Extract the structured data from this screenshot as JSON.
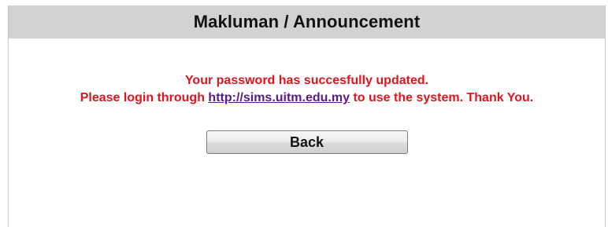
{
  "announcement": {
    "title": "Makluman / Announcement",
    "line1": "Your password has succesfully updated.",
    "line2_prefix": "Please login through",
    "link_text": "http://sims.uitm.edu.my",
    "line2_suffix": "to use the system. Thank You.",
    "back_label": "Back"
  },
  "colors": {
    "header_bg": "#d2d2d2",
    "message_red": "#e0141e",
    "link_purple": "#5a1a86"
  }
}
